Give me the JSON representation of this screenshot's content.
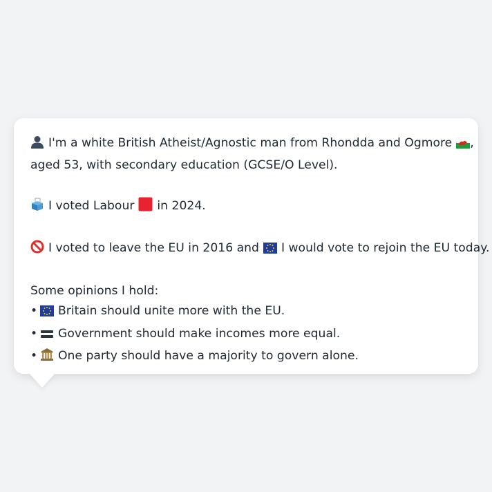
{
  "profile": {
    "line1": "I'm a white British Atheist/Agnostic man from Rhondda and Ogmore",
    "line1_tail": ",",
    "line2": "aged 53, with secondary education (GCSE/O Level).",
    "vote_prefix": "I voted Labour",
    "vote_suffix": "in 2024.",
    "brexit_prefix": "I voted to leave the EU in 2016 and",
    "brexit_suffix": "I would vote to rejoin the EU today.",
    "opinions_heading": "Some opinions I hold:",
    "opinions": [
      {
        "bullet": "•",
        "text": "Britain should unite more with the EU.",
        "icon": "eu-flag-icon"
      },
      {
        "bullet": "•",
        "text": "Government should make incomes more equal.",
        "icon": "equals-icon"
      },
      {
        "bullet": "•",
        "text": "One party should have a majority to govern alone.",
        "icon": "classical-building-icon"
      }
    ]
  },
  "colors": {
    "background": "#f2f3f5",
    "bubble": "#ffffff",
    "text": "#1f2933",
    "labour_red": "#e8222e",
    "eu_blue": "#1f3c9c",
    "eu_star": "#f5d100"
  }
}
